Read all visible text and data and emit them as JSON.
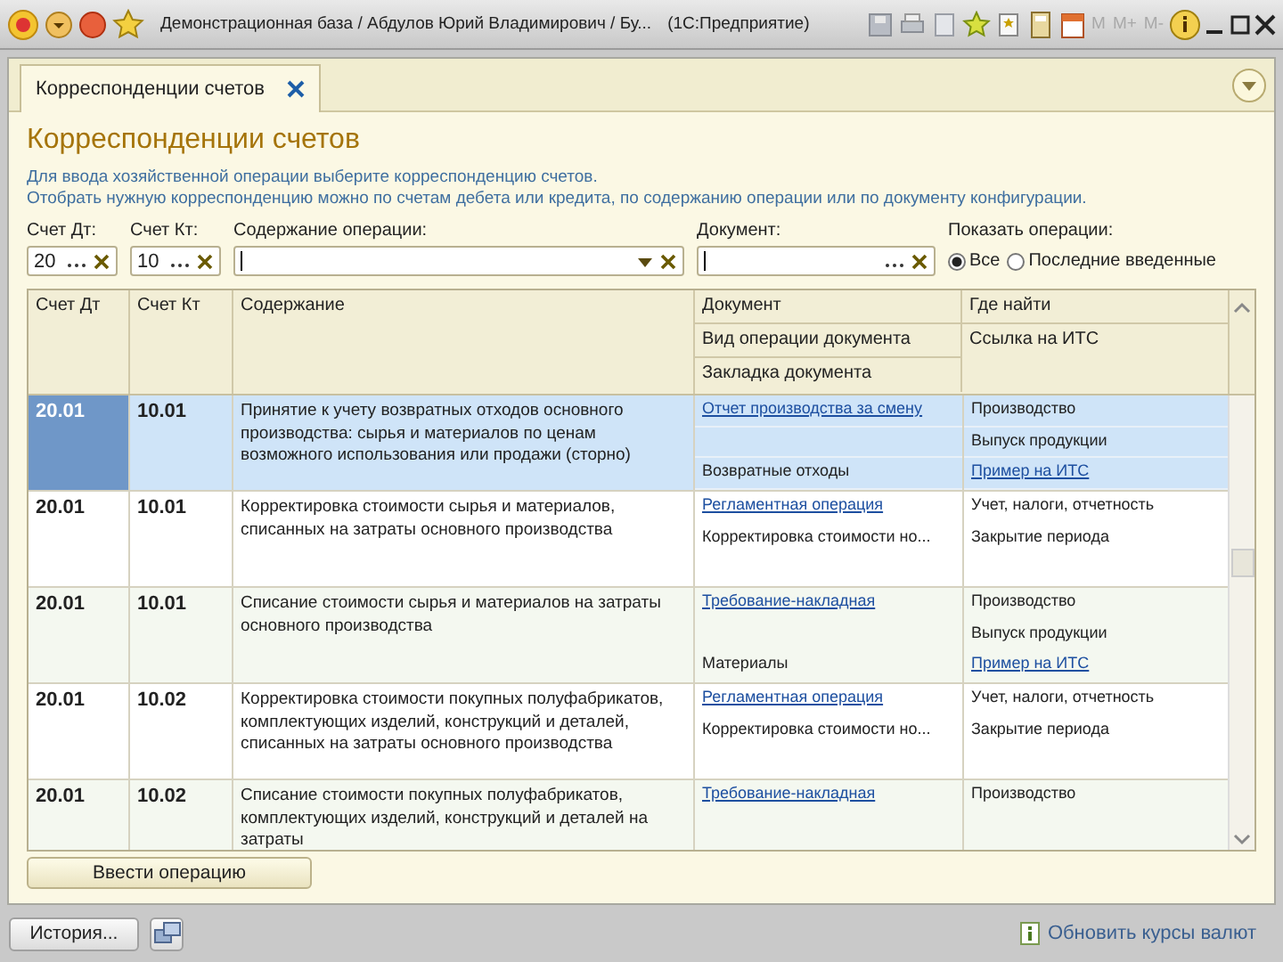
{
  "window": {
    "title": "Демонстрационная база / Абдулов Юрий Владимирович / Бу...",
    "app": "(1С:Предприятие)"
  },
  "toolbar": {
    "memory_buttons": [
      {
        "label": "M",
        "disabled": true
      },
      {
        "label": "M+",
        "disabled": true
      },
      {
        "label": "M-",
        "disabled": true
      }
    ]
  },
  "tabs": [
    {
      "label": "Корреспонденции счетов",
      "selected": true
    }
  ],
  "heading": "Корреспонденции счетов",
  "hint_lines": [
    "Для ввода хозяйственной операции выберите корреспонденцию счетов.",
    "Отобрать нужную корреспонденцию можно по счетам дебета или кредита, по содержанию операции или по документу конфигурации."
  ],
  "filters": {
    "debit": {
      "label": "Счет Дт:",
      "value": "20"
    },
    "credit": {
      "label": "Счет Кт:",
      "value": "10"
    },
    "content": {
      "label": "Содержание операции:"
    },
    "document": {
      "label": "Документ:"
    },
    "show": {
      "label": "Показать операции:",
      "options": [
        {
          "label": "Все",
          "selected": true
        },
        {
          "label": "Последние введенные",
          "selected": false
        }
      ]
    }
  },
  "table": {
    "columns": {
      "debit": "Счет Дт",
      "credit": "Счет Кт",
      "content": "Содержание",
      "document": [
        "Документ",
        "Вид операции документа",
        "Закладка документа"
      ],
      "where": [
        "Где найти",
        "Ссылка на ИТС"
      ]
    },
    "rows": [
      {
        "selected": true,
        "debit": "20.01",
        "credit": "10.01",
        "content": "Принятие к учету возвратных отходов основного производства: сырья и материалов по ценам возможного использования или продажи (сторно)",
        "document": {
          "link": "Отчет производства за смену",
          "tab": "Возвратные отходы"
        },
        "where": [
          {
            "kind": "text",
            "text": "Производство"
          },
          {
            "kind": "text",
            "text": "Выпуск продукции"
          },
          {
            "kind": "link",
            "text": "Пример на ИТС"
          }
        ]
      },
      {
        "selected": false,
        "debit": "20.01",
        "credit": "10.01",
        "content": "Корректировка стоимости сырья и материалов, списанных на затраты основного производства",
        "document": {
          "link": "Регламентная операция",
          "operation": "Корректировка стоимости но..."
        },
        "where": [
          {
            "kind": "text",
            "text": "Учет, налоги, отчетность"
          },
          {
            "kind": "text",
            "text": "Закрытие периода"
          }
        ]
      },
      {
        "selected": false,
        "debit": "20.01",
        "credit": "10.01",
        "content": "Списание стоимости сырья и материалов на затраты основного производства",
        "document": {
          "link": "Требование-накладная",
          "tab": "Материалы"
        },
        "where": [
          {
            "kind": "text",
            "text": "Производство"
          },
          {
            "kind": "text",
            "text": "Выпуск продукции"
          },
          {
            "kind": "link",
            "text": "Пример на ИТС"
          }
        ]
      },
      {
        "selected": false,
        "debit": "20.01",
        "credit": "10.02",
        "content": "Корректировка стоимости покупных полуфабрикатов, комплектующих изделий, конструкций и деталей, списанных на затраты основного производства",
        "document": {
          "link": "Регламентная операция",
          "operation": "Корректировка стоимости но..."
        },
        "where": [
          {
            "kind": "text",
            "text": "Учет, налоги, отчетность"
          },
          {
            "kind": "text",
            "text": "Закрытие периода"
          }
        ]
      },
      {
        "selected": false,
        "debit": "20.01",
        "credit": "10.02",
        "content": "Списание стоимости покупных полуфабрикатов, комплектующих изделий, конструкций и деталей на затраты",
        "document": {
          "link": "Требование-накладная"
        },
        "where": [
          {
            "kind": "text",
            "text": "Производство"
          }
        ]
      }
    ]
  },
  "buttons": {
    "enter": "Ввести операцию",
    "history": "История..."
  },
  "status_bar": {
    "link": "Обновить курсы валют"
  }
}
